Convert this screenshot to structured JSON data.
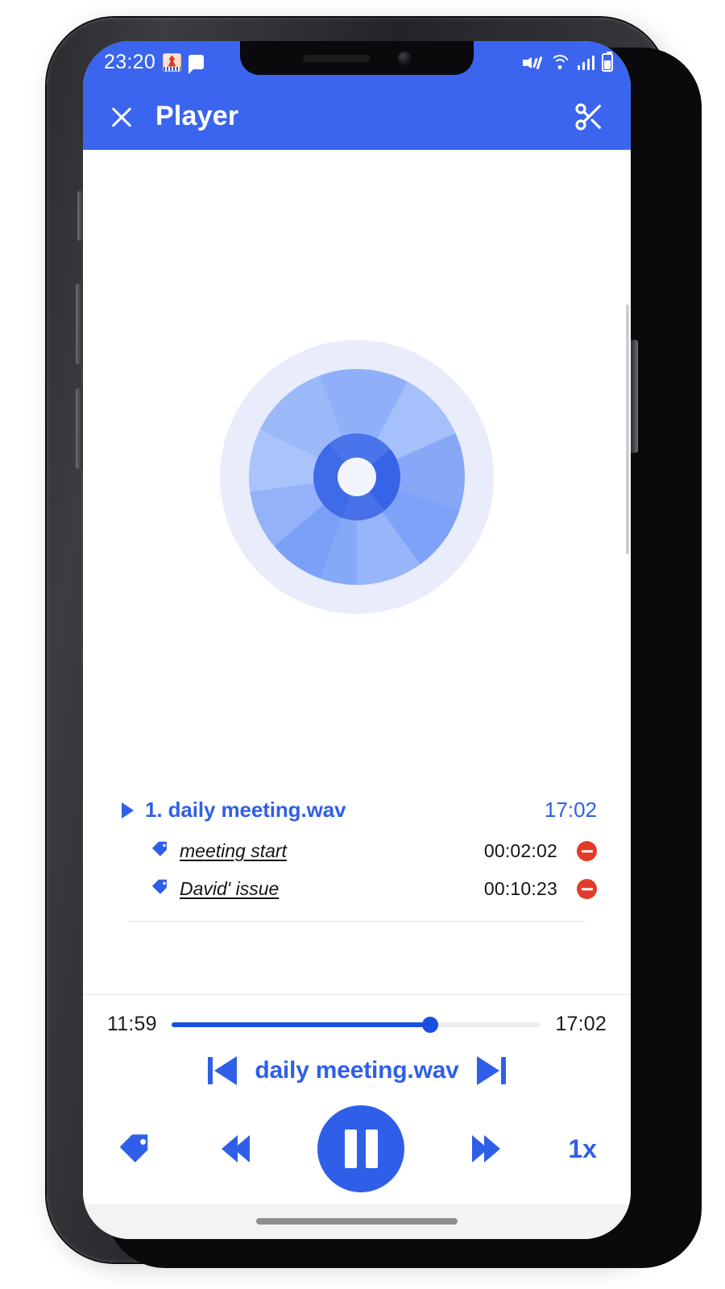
{
  "statusbar": {
    "time": "23:20",
    "icons": [
      "app-notification-icon",
      "chat-bubble-icon",
      "mute-icon",
      "wifi-icon",
      "signal-icon",
      "battery-icon"
    ]
  },
  "appbar": {
    "title": "Player",
    "close_icon": "close-icon",
    "cut_icon": "scissors-icon",
    "bg_color": "#3b65ef"
  },
  "artwork": {
    "icon": "compact-disc-icon",
    "halo_color": "#e9ecfa",
    "disc_color": "#8fb0f8",
    "hub_color": "#3f6ae8",
    "hole_color": "#f2f4fd"
  },
  "tracklist": {
    "track": {
      "play_icon": "play-triangle-icon",
      "name": "1. daily meeting.wav",
      "duration": "17:02",
      "color": "#2f5fe8"
    },
    "bookmarks": [
      {
        "icon": "tag-icon",
        "label": "meeting start",
        "time": "00:02:02",
        "delete_icon": "remove-circle-icon"
      },
      {
        "icon": "tag-icon",
        "label": "David' issue",
        "time": "00:10:23",
        "delete_icon": "remove-circle-icon"
      }
    ],
    "delete_color": "#e33b2a"
  },
  "player": {
    "elapsed": "11:59",
    "total": "17:02",
    "progress_percent": 70,
    "now_playing": "daily meeting.wav",
    "prev_icon": "skip-previous-icon",
    "next_icon": "skip-next-icon",
    "bookmark_icon": "tag-icon",
    "rewind_icon": "rewind-icon",
    "play_pause_icon": "pause-icon",
    "forward_icon": "fast-forward-icon",
    "speed_label": "1x",
    "accent_color": "#2f5fe8"
  }
}
